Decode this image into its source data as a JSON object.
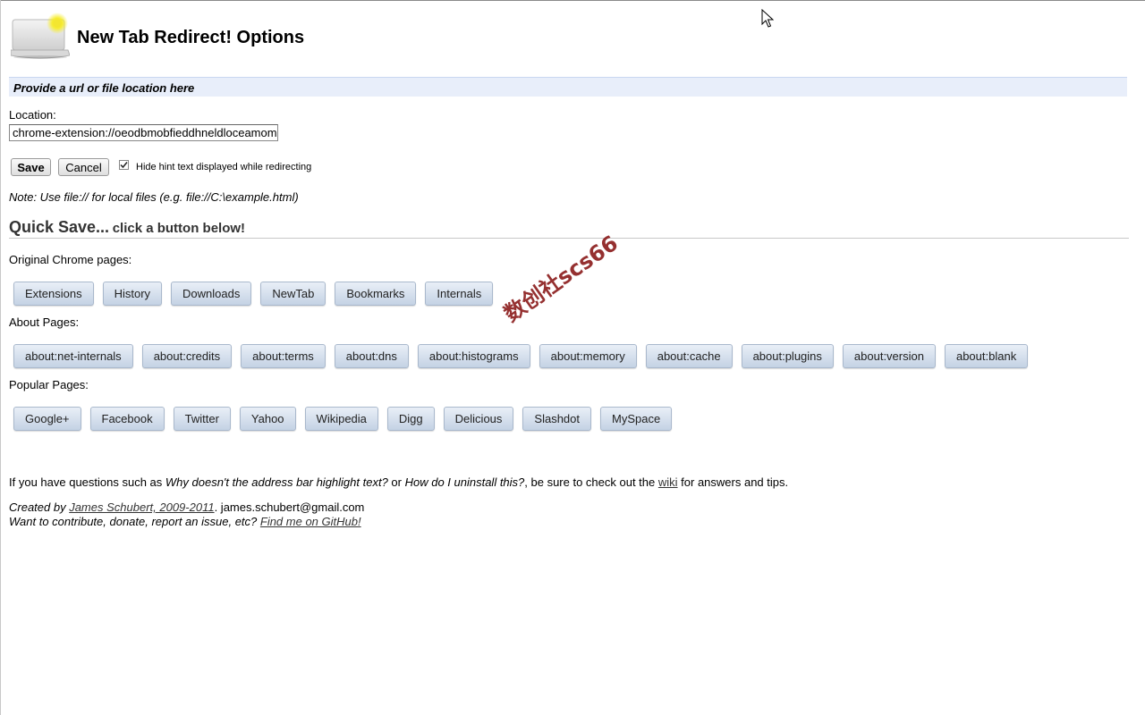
{
  "header": {
    "title": "New Tab Redirect! Options",
    "logo_icon": "laptop-with-glowing-bulb-icon"
  },
  "section": {
    "title": "Provide a url or file location here"
  },
  "location": {
    "label": "Location:",
    "value": "chrome-extension://oeodbmobfieddhneldloceamom"
  },
  "actions": {
    "save_label": "Save",
    "cancel_label": "Cancel",
    "hide_hint_label": "Hide hint text displayed while redirecting",
    "hide_hint_checked": true
  },
  "note": "Note: Use file:// for local files (e.g. file://C:\\example.html)",
  "quick_save": {
    "title": "Quick Save...",
    "subtitle": "click a button below!"
  },
  "groups": [
    {
      "label": "Original Chrome pages:",
      "buttons": [
        "Extensions",
        "History",
        "Downloads",
        "NewTab",
        "Bookmarks",
        "Internals"
      ]
    },
    {
      "label": "About Pages:",
      "buttons": [
        "about:net-internals",
        "about:credits",
        "about:terms",
        "about:dns",
        "about:histograms",
        "about:memory",
        "about:cache",
        "about:plugins",
        "about:version",
        "about:blank"
      ]
    },
    {
      "label": "Popular Pages:",
      "buttons": [
        "Google+",
        "Facebook",
        "Twitter",
        "Yahoo",
        "Wikipedia",
        "Digg",
        "Delicious",
        "Slashdot",
        "MySpace"
      ]
    }
  ],
  "help": {
    "prefix": "If you have questions such as ",
    "q1": "Why doesn't the address bar highlight text?",
    "mid": " or ",
    "q2": "How do I uninstall this?",
    "mid2": ", be sure to check out the ",
    "link": "wiki",
    "suffix": " for answers and tips."
  },
  "credits": {
    "created_prefix": "Created by ",
    "author_link": "James Schubert, 2009-2011",
    "email": ". james.schubert@gmail.com",
    "contribute_prefix": "Want to contribute, donate, report an issue, etc? ",
    "github_link": "Find me on GitHub!"
  },
  "watermark": "数创社scs66",
  "colors": {
    "section_bar": "#e8eefa",
    "quick_button": "#c4d2e4",
    "watermark": "#8a1a1a"
  }
}
